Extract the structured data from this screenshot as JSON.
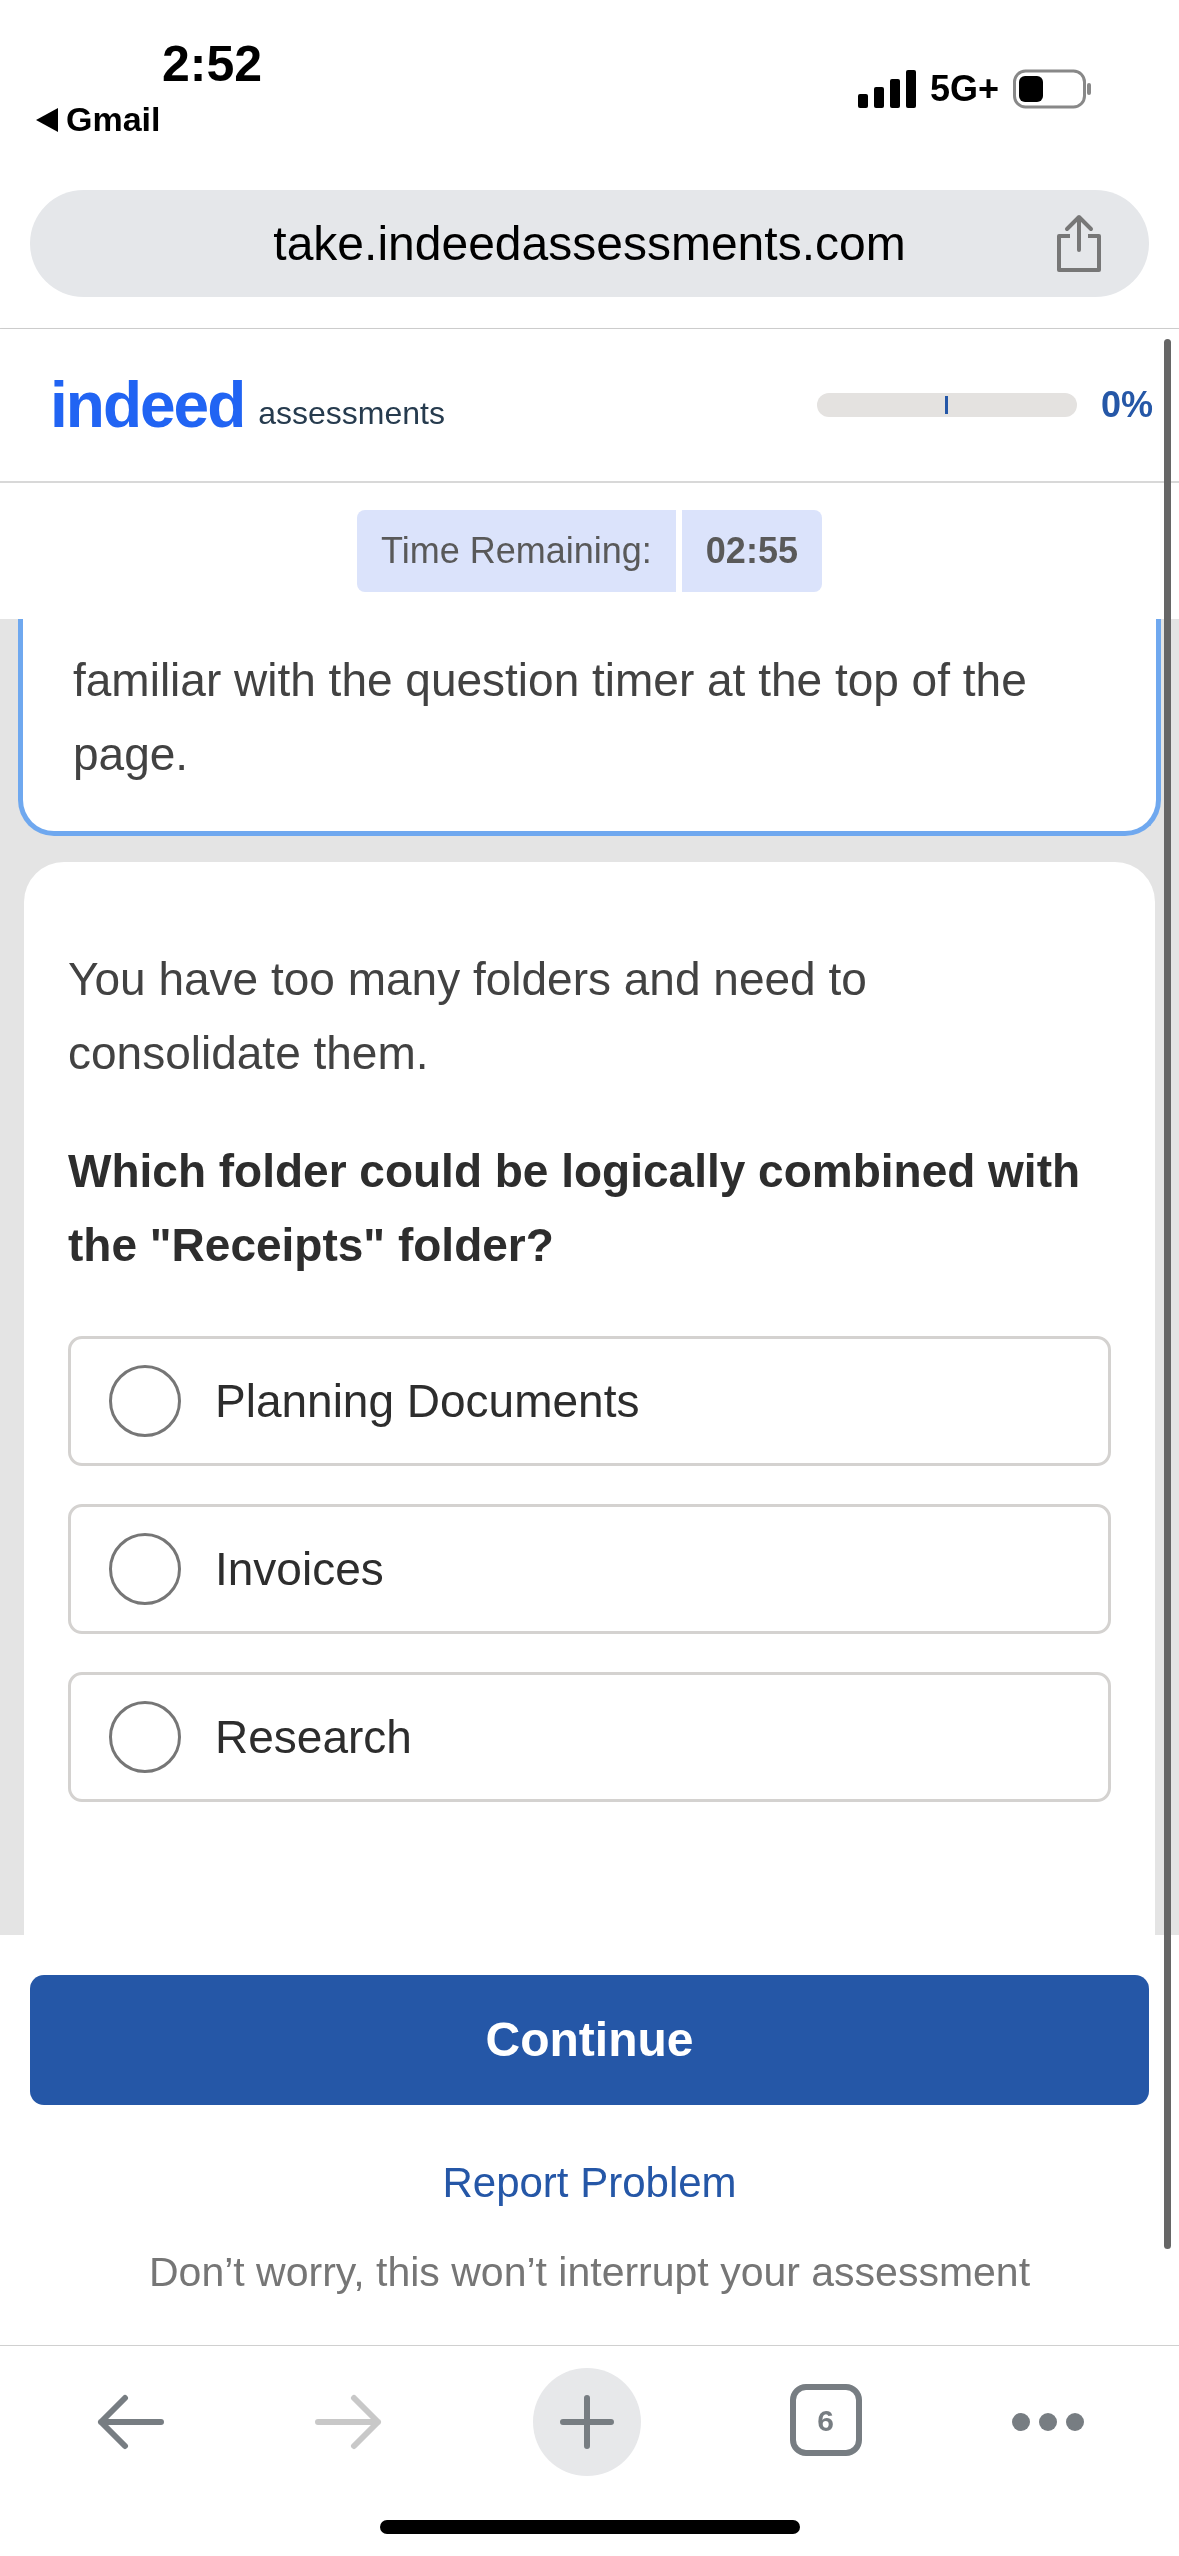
{
  "status_bar": {
    "time": "2:52",
    "back_app": "Gmail",
    "network": "5G+"
  },
  "browser": {
    "url": "take.indeedassessments.com"
  },
  "header": {
    "logo": "indeed",
    "logo_sub": "assessments",
    "progress": {
      "level": 0,
      "reading": "0%"
    }
  },
  "timer": {
    "label": "Time Remaining:",
    "value": "02:55"
  },
  "intro": {
    "text": "familiar with the question timer at the top of the page."
  },
  "question": {
    "prompt": "You have too many folders and need to consolidate them.",
    "text": "Which folder could be logically combined with the \"Receipts\" folder?",
    "options": [
      {
        "label": "Planning Documents",
        "selected": false
      },
      {
        "label": "Invoices",
        "selected": false
      },
      {
        "label": "Research",
        "selected": false
      }
    ]
  },
  "continue_button": "Continue",
  "report_link": "Report Problem",
  "note": "Don’t worry, this won’t interrupt your assessment",
  "toolbar": {
    "tab_count": "6"
  }
}
